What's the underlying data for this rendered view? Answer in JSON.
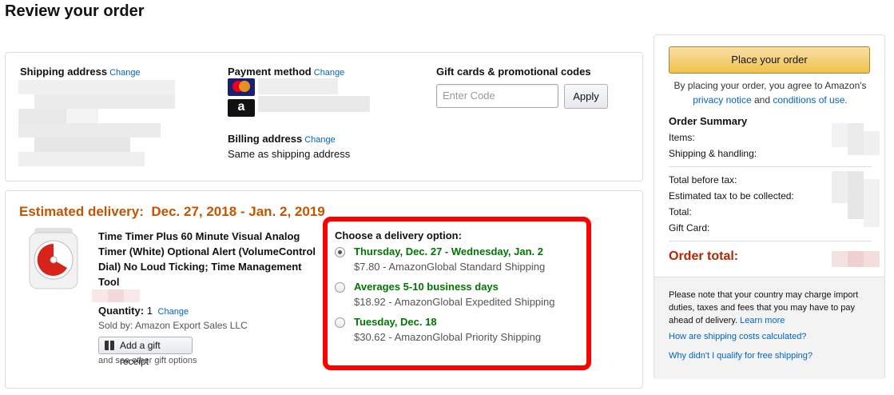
{
  "page_title": "Review your order",
  "shipping": {
    "label": "Shipping address",
    "change": "Change"
  },
  "payment": {
    "label": "Payment method",
    "change": "Change",
    "billing_label": "Billing address",
    "billing_change": "Change",
    "billing_value": "Same as shipping address"
  },
  "gift_codes": {
    "label": "Gift cards & promotional codes",
    "placeholder": "Enter Code",
    "apply": "Apply"
  },
  "delivery": {
    "estimated_label": "Estimated delivery:",
    "estimated_dates": "Dec. 27, 2018 - Jan. 2, 2019",
    "choose_label": "Choose a delivery option:",
    "options": [
      {
        "name": "Thursday, Dec. 27 - Wednesday, Jan. 2",
        "price": "$7.80 - AmazonGlobal Standard Shipping",
        "selected": true
      },
      {
        "name": "Averages 5-10 business days",
        "price": "$18.92 - AmazonGlobal Expedited Shipping",
        "selected": false
      },
      {
        "name": "Tuesday, Dec. 18",
        "price": "$30.62 - AmazonGlobal Priority Shipping",
        "selected": false
      }
    ],
    "highlight_color": "#ff0000"
  },
  "item": {
    "title": "Time Timer Plus 60 Minute Visual Analog Timer (White) Optional Alert (VolumeControl Dial) No Loud Ticking; Time Management Tool",
    "quantity_label": "Quantity:",
    "quantity": "1",
    "quantity_change": "Change",
    "sold_by": "Sold by: Amazon Export Sales LLC",
    "gift_receipt": "Add a gift receipt",
    "other_gift": "and see other gift options"
  },
  "summary": {
    "place_order": "Place your order",
    "agree_prefix": "By placing your order, you agree to Amazon's",
    "privacy": "privacy notice",
    "and": "and",
    "conditions": "conditions of use.",
    "title": "Order Summary",
    "items": "Items:",
    "shipping_handling": "Shipping & handling:",
    "total_before_tax": "Total before tax:",
    "estimated_tax": "Estimated tax to be collected:",
    "total": "Total:",
    "gift_card": "Gift Card:",
    "order_total": "Order total:",
    "note": "Please note that your country may charge import duties, taxes and fees that you may have to pay ahead of delivery.",
    "learn_more": "Learn more",
    "faq1": "How are shipping costs calculated?",
    "faq2": "Why didn't I qualify for free shipping?",
    "button_color": "#f0c14b",
    "total_color": "#b12704"
  }
}
